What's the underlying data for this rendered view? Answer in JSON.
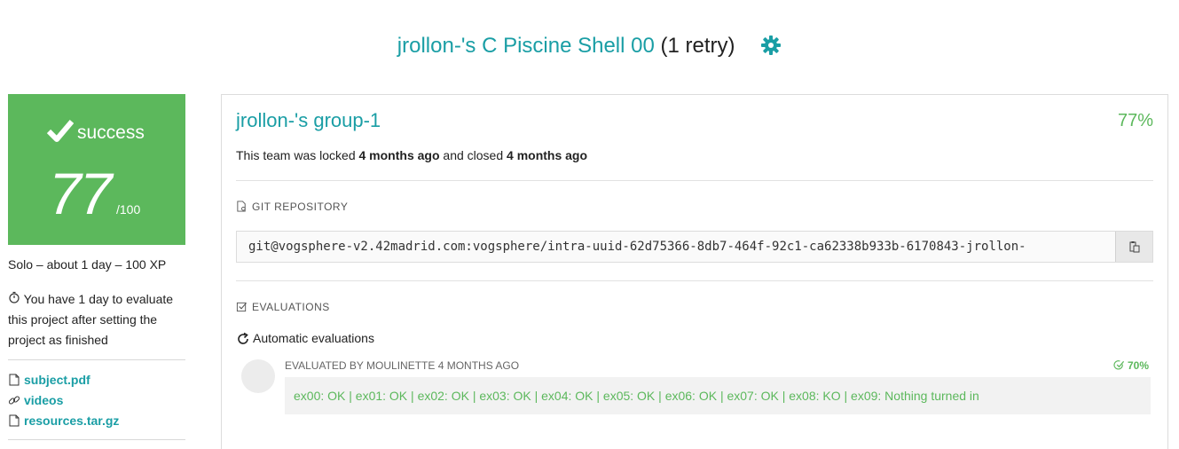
{
  "header": {
    "project_title": "jrollon-'s C Piscine Shell 00",
    "retry": "(1 retry)",
    "settings_icon": "gear-icon"
  },
  "colors": {
    "accent": "#1a9ea5",
    "success": "#5cb85c"
  },
  "score_card": {
    "status": "success",
    "score": "77",
    "max": "/100"
  },
  "sidebar": {
    "meta": "Solo – about 1 day – 100 XP",
    "hint": "You have 1 day to evaluate this project after setting the project as finished",
    "links": [
      {
        "label": "subject.pdf",
        "icon": "file-icon"
      },
      {
        "label": "videos",
        "icon": "link-icon"
      },
      {
        "label": "resources.tar.gz",
        "icon": "file-icon"
      }
    ]
  },
  "team": {
    "name": "jrollon-'s group-1",
    "percent": "77%",
    "lock_prefix": "This team was locked",
    "locked_ago": "4 months ago",
    "lock_middle": "and closed",
    "closed_ago": "4 months ago"
  },
  "git": {
    "label": "GIT REPOSITORY",
    "url": "git@vogsphere-v2.42madrid.com:vogsphere/intra-uuid-62d75366-8db7-464f-92c1-ca62338b933b-6170843-jrollon-"
  },
  "evaluations": {
    "label": "EVALUATIONS",
    "automatic_label": "Automatic evaluations",
    "entries": [
      {
        "evaluated_by": "EVALUATED BY MOULINETTE 4 MONTHS AGO",
        "score": "70%",
        "result": "ex00: OK | ex01: OK | ex02: OK | ex03: OK | ex04: OK | ex05: OK | ex06: OK | ex07: OK | ex08: KO | ex09: Nothing turned in"
      }
    ]
  }
}
